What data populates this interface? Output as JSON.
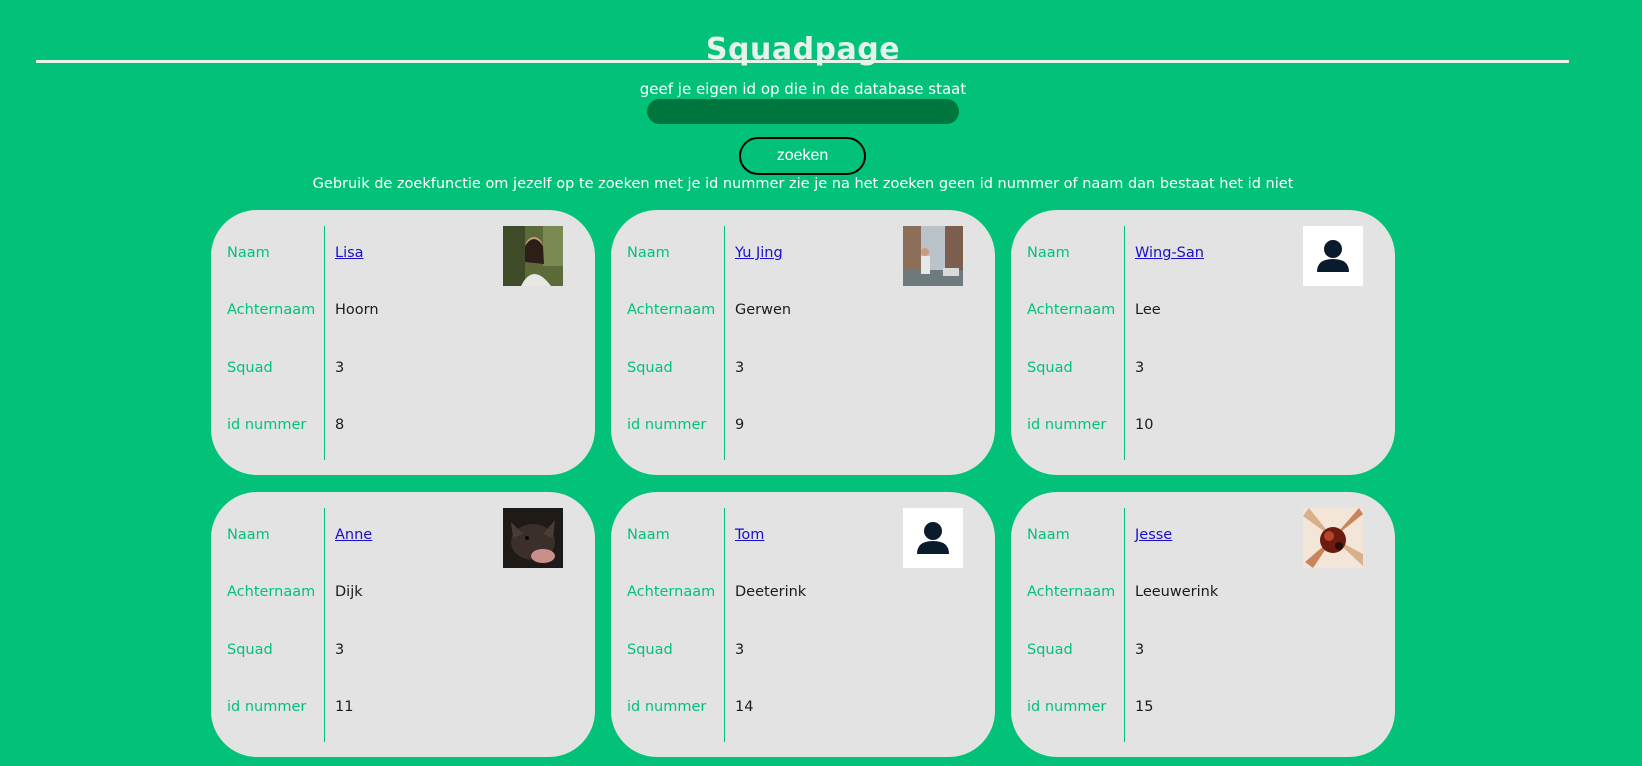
{
  "page": {
    "title": "Squadpage",
    "search_label": "geef je eigen id op die in de database staat",
    "search_value": "",
    "search_button": "zoeken",
    "hint": "Gebruik de zoekfunctie om jezelf op te zoeken met je id nummer zie je na het zoeken geen id nummer of naam dan bestaat het id niet"
  },
  "labels": {
    "name": "Naam",
    "surname": "Achternaam",
    "squad": "Squad",
    "id": "id nummer"
  },
  "colors": {
    "background": "#02c27a",
    "card": "#e3e3e3",
    "accent_label": "#02c27a",
    "link": "#1a0dcc",
    "input": "#00763f"
  },
  "members": [
    {
      "first_name": "Lisa",
      "last_name": "Hoorn",
      "squad": "3",
      "id": "8",
      "avatar": "photo"
    },
    {
      "first_name": "Yu Jing",
      "last_name": "Gerwen",
      "squad": "3",
      "id": "9",
      "avatar": "photo"
    },
    {
      "first_name": "Wing-San",
      "last_name": "Lee",
      "squad": "3",
      "id": "10",
      "avatar": "default-user-icon"
    },
    {
      "first_name": "Anne",
      "last_name": "Dijk",
      "squad": "3",
      "id": "11",
      "avatar": "photo"
    },
    {
      "first_name": "Tom",
      "last_name": "Deeterink",
      "squad": "3",
      "id": "14",
      "avatar": "default-user-icon"
    },
    {
      "first_name": "Jesse",
      "last_name": "Leeuwerink",
      "squad": "3",
      "id": "15",
      "avatar": "photo"
    }
  ]
}
